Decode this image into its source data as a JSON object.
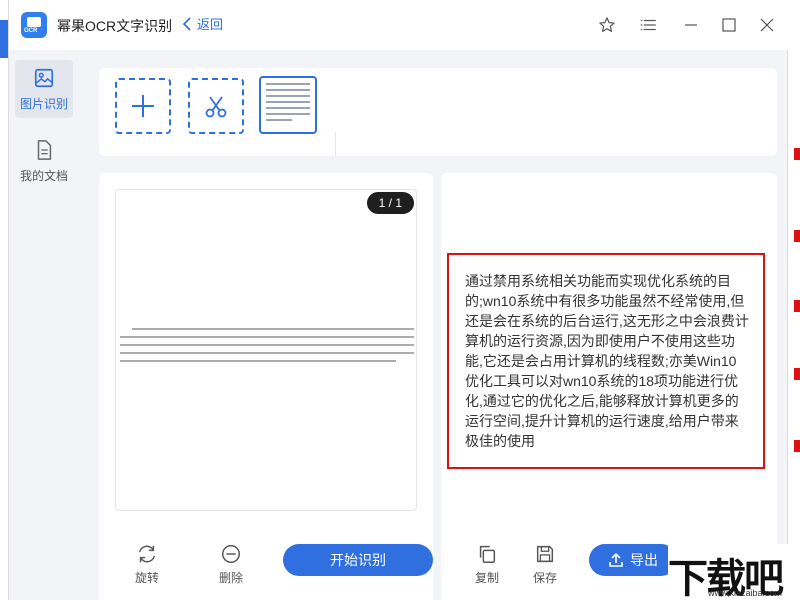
{
  "app": {
    "title": "幂果OCR文字识别",
    "back_label": "返回"
  },
  "sidebar": {
    "items": [
      {
        "label": "图片识别",
        "active": true
      },
      {
        "label": "我的文档",
        "active": false
      }
    ]
  },
  "preview": {
    "page_indicator": "1 / 1"
  },
  "actions_left": {
    "rotate_label": "旋转",
    "delete_label": "删除",
    "start_label": "开始识别"
  },
  "actions_right": {
    "copy_label": "复制",
    "save_label": "保存",
    "export_label": "导出"
  },
  "result": {
    "text": "通过禁用系统相关功能而实现优化系统的目的;wn10系统中有很多功能虽然不经常使用,但还是会在系统的后台运行,这无形之中会浪费计算机的运行资源,因为即使用户不使用这些功能,它还是会占用计算机的线程数;亦美Win10优化工具可以对wn10系统的18项功能进行优化,通过它的优化之后,能够释放计算机更多的运行空间,提升计算机的运行速度,给用户带来极佳的使用"
  },
  "watermark": {
    "logo": "下载吧",
    "url": "www.xiazaiba.com"
  },
  "colors": {
    "accent": "#2f6fe0",
    "highlight_border": "#dd1111"
  }
}
